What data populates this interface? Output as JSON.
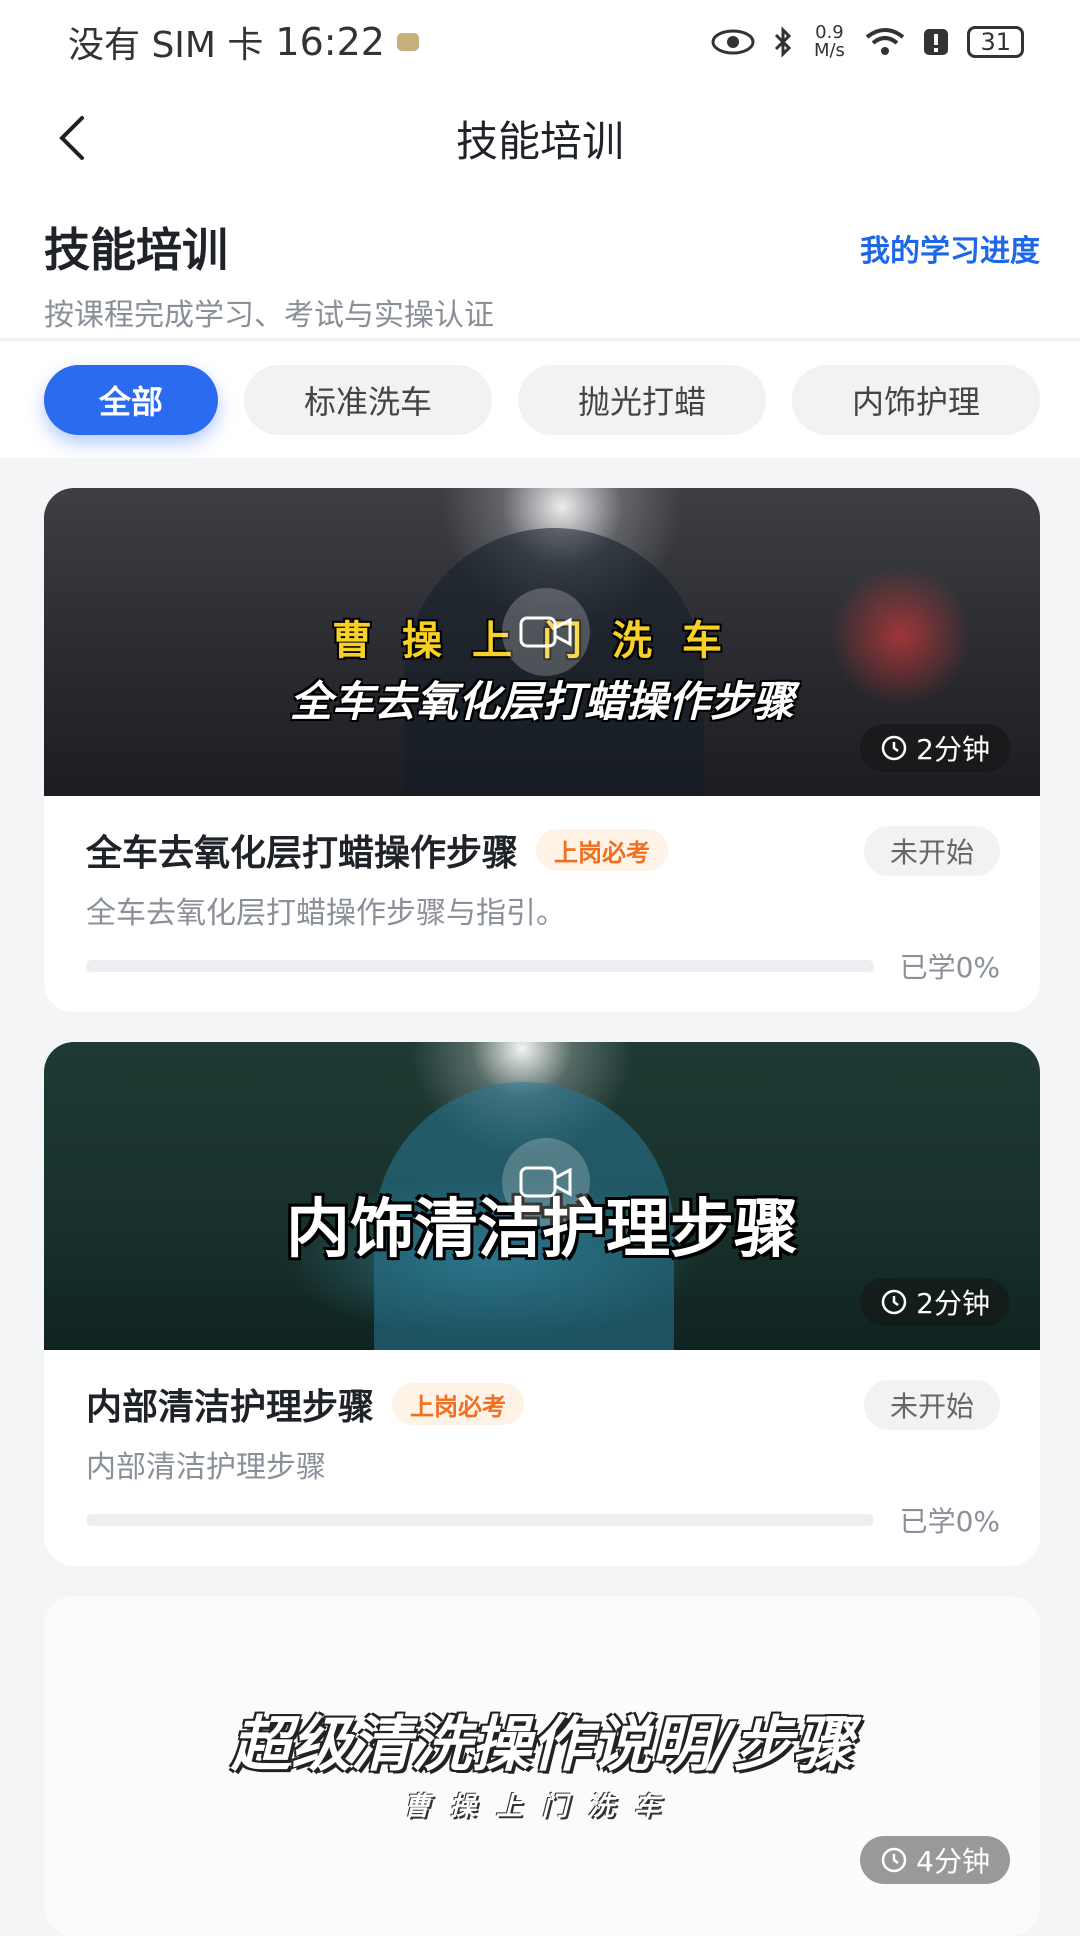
{
  "status_bar": {
    "carrier": "没有 SIM 卡",
    "time": "16:22",
    "speed": "0.9 M/s",
    "battery": "31"
  },
  "nav": {
    "title": "技能培训"
  },
  "header": {
    "title": "技能培训",
    "subtitle": "按课程完成学习、考试与实操认证",
    "progress_link": "我的学习进度"
  },
  "tabs": [
    {
      "label": "全部",
      "active": true
    },
    {
      "label": "标准洗车",
      "active": false
    },
    {
      "label": "抛光打蜡",
      "active": false
    },
    {
      "label": "内饰护理",
      "active": false
    }
  ],
  "courses": [
    {
      "thumb_line1": "曹操上门洗车",
      "thumb_line2": "全车去氧化层打蜡操作步骤",
      "duration": "2分钟",
      "title": "全车去氧化层打蜡操作步骤",
      "tag": "上岗必考",
      "status": "未开始",
      "desc": "全车去氧化层打蜡操作步骤与指引。",
      "progress_label": "已学0%",
      "progress": 0
    },
    {
      "thumb_big": "内饰清洁护理步骤",
      "duration": "2分钟",
      "title": "内部清洁护理步骤",
      "tag": "上岗必考",
      "status": "未开始",
      "desc": "内部清洁护理步骤",
      "progress_label": "已学0%",
      "progress": 0
    },
    {
      "thumb_line1": "超级清洗操作说明/步骤",
      "thumb_line2": "曹操上门洗车",
      "duration": "4分钟"
    }
  ],
  "colors": {
    "accent": "#2b6bf0",
    "tag_text": "#f07020",
    "tag_bg": "#fff2e6"
  }
}
